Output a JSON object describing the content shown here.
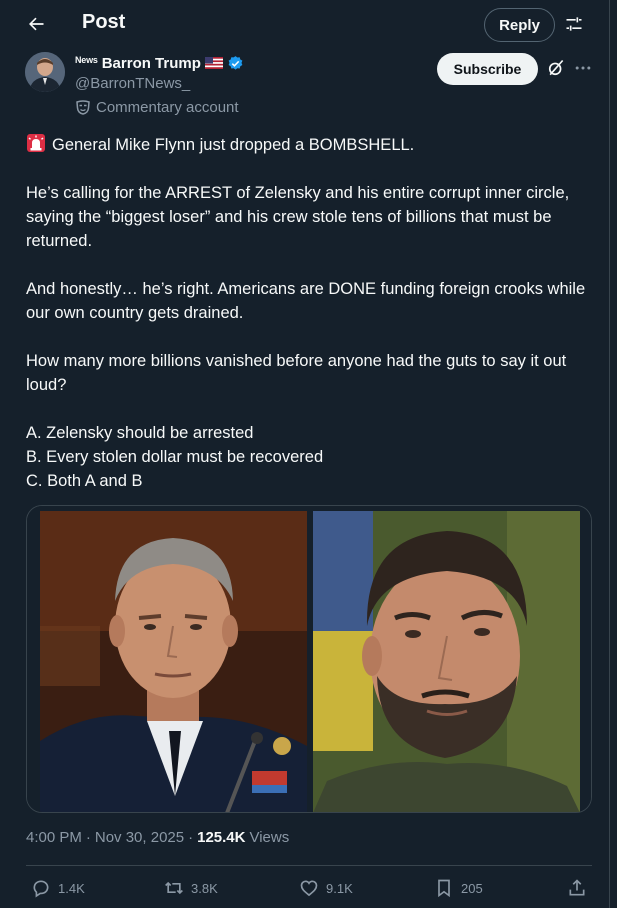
{
  "header": {
    "title": "Post",
    "reply_label": "Reply"
  },
  "author": {
    "affiliate_badge": "News",
    "display_name": "Barron Trump",
    "handle": "@BarronTNews_",
    "label": "Commentary account",
    "subscribe_label": "Subscribe"
  },
  "post": {
    "lines": [
      "General Mike Flynn just dropped a BOMBSHELL.",
      "He’s calling for the ARREST of Zelensky and his entire corrupt inner circle, saying the “biggest loser” and his crew stole tens of billions that must be returned.",
      "And honestly… he’s right. Americans are DONE funding foreign crooks while our own country gets drained.",
      "How many more billions vanished before anyone had the guts to say it out loud?",
      "A. Zelensky should be arrested",
      "B. Every stolen dollar must be recovered",
      "C. Both A and B"
    ]
  },
  "meta": {
    "time": "4:00 PM",
    "sep1": "·",
    "date": "Nov 30, 2025",
    "sep2": "·",
    "views": "125.4K",
    "views_label": "Views"
  },
  "actions": {
    "replies": "1.4K",
    "reposts": "3.8K",
    "likes": "9.1K",
    "bookmarks": "205"
  },
  "colors": {
    "background": "#15202b",
    "text": "#f7f9f9",
    "muted": "#8b98a5",
    "border": "#38444d",
    "verified": "#1d9bf0"
  },
  "icons": [
    "back-arrow-icon",
    "sliders-icon",
    "verified-badge-icon",
    "us-flag-icon",
    "commentary-mask-icon",
    "grok-icon",
    "more-icon",
    "siren-icon",
    "reply-icon",
    "repost-icon",
    "like-icon",
    "bookmark-icon",
    "share-icon"
  ]
}
